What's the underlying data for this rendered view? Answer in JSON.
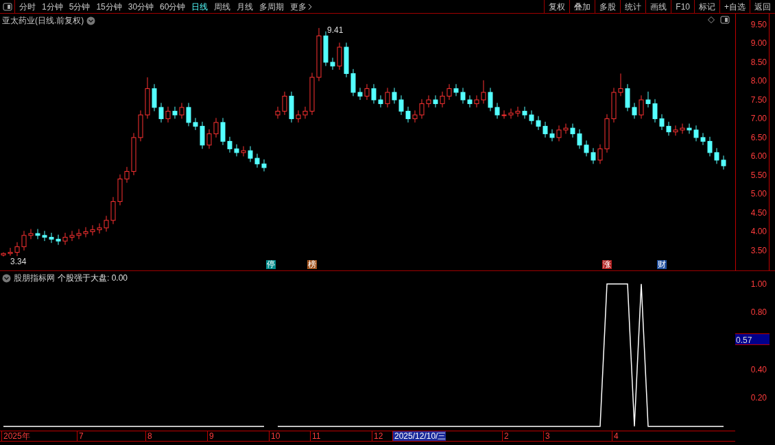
{
  "toolbar": {
    "periods": [
      {
        "label": "分时",
        "selected": false
      },
      {
        "label": "1分钟",
        "selected": false
      },
      {
        "label": "5分钟",
        "selected": false
      },
      {
        "label": "15分钟",
        "selected": false
      },
      {
        "label": "30分钟",
        "selected": false
      },
      {
        "label": "60分钟",
        "selected": false
      },
      {
        "label": "日线",
        "selected": true
      },
      {
        "label": "周线",
        "selected": false
      },
      {
        "label": "月线",
        "selected": false
      },
      {
        "label": "多周期",
        "selected": false
      }
    ],
    "more": "更多",
    "buttons": [
      "复权",
      "叠加",
      "多股",
      "统计",
      "画线",
      "F10",
      "标记",
      "+自选",
      "返回"
    ]
  },
  "price_chart": {
    "title": "亚太药业(日线.前复权)",
    "high_label": "9.41",
    "low_label": "3.34",
    "markers": [
      {
        "text": "停",
        "color": "#008b8b"
      },
      {
        "text": "榜",
        "color": "#a0521d"
      },
      {
        "text": "涨",
        "color": "#b02020"
      },
      {
        "text": "财",
        "color": "#1f4f9f"
      }
    ],
    "chart_data": {
      "type": "candlestick",
      "ylim": [
        2.97,
        9.79
      ],
      "yticks": [
        {
          "value": 9.5,
          "label": "9.50"
        },
        {
          "value": 9,
          "label": "9.00"
        },
        {
          "value": 8.5,
          "label": "8.50"
        },
        {
          "value": 8,
          "label": "8.00"
        },
        {
          "value": 7.5,
          "label": "7.50"
        },
        {
          "value": 7,
          "label": "7.00"
        },
        {
          "value": 6.5,
          "label": "6.50"
        },
        {
          "value": 6,
          "label": "6.00"
        },
        {
          "value": 5.5,
          "label": "5.50"
        },
        {
          "value": 5,
          "label": "5.00"
        },
        {
          "value": 4.5,
          "label": "4.50"
        },
        {
          "value": 4,
          "label": "4.00"
        },
        {
          "value": 3.5,
          "label": "3.50"
        }
      ],
      "ohlc": [
        [
          3.38,
          3.45,
          3.34,
          3.42
        ],
        [
          3.42,
          3.57,
          3.36,
          3.45
        ],
        [
          3.45,
          3.72,
          3.35,
          3.6
        ],
        [
          3.6,
          4.02,
          3.5,
          3.9
        ],
        [
          3.9,
          4.07,
          3.8,
          3.95
        ],
        [
          3.95,
          4.07,
          3.8,
          3.9
        ],
        [
          3.9,
          4.02,
          3.75,
          3.85
        ],
        [
          3.85,
          3.97,
          3.7,
          3.8
        ],
        [
          3.8,
          3.92,
          3.65,
          3.75
        ],
        [
          3.75,
          3.97,
          3.65,
          3.85
        ],
        [
          3.85,
          4.02,
          3.75,
          3.9
        ],
        [
          3.9,
          4.07,
          3.8,
          3.95
        ],
        [
          3.95,
          4.12,
          3.85,
          4.0
        ],
        [
          4.0,
          4.17,
          3.9,
          4.05
        ],
        [
          4.05,
          4.22,
          3.95,
          4.1
        ],
        [
          4.1,
          4.42,
          4.0,
          4.3
        ],
        [
          4.3,
          4.92,
          4.2,
          4.8
        ],
        [
          4.8,
          5.52,
          4.7,
          5.4
        ],
        [
          5.4,
          5.72,
          5.3,
          5.6
        ],
        [
          5.6,
          6.62,
          5.5,
          6.5
        ],
        [
          6.5,
          7.22,
          6.4,
          7.1
        ],
        [
          7.1,
          8.1,
          7.0,
          7.8
        ],
        [
          7.8,
          7.92,
          7.2,
          7.3
        ],
        [
          7.3,
          7.42,
          6.9,
          7.0
        ],
        [
          7.0,
          7.32,
          6.9,
          7.2
        ],
        [
          7.2,
          7.32,
          7.0,
          7.1
        ],
        [
          7.1,
          7.42,
          7.0,
          7.3
        ],
        [
          7.3,
          7.42,
          6.8,
          6.9
        ],
        [
          6.9,
          7.02,
          6.7,
          6.8
        ],
        [
          6.8,
          6.92,
          6.2,
          6.3
        ],
        [
          6.3,
          6.72,
          6.2,
          6.6
        ],
        [
          6.6,
          7.02,
          6.5,
          6.9
        ],
        [
          6.9,
          7.02,
          6.3,
          6.4
        ],
        [
          6.4,
          6.52,
          6.1,
          6.2
        ],
        [
          6.2,
          6.32,
          6.0,
          6.1
        ],
        [
          6.1,
          6.27,
          6.0,
          6.15
        ],
        [
          6.15,
          6.27,
          5.85,
          5.95
        ],
        [
          5.95,
          6.07,
          5.7,
          5.8
        ],
        [
          5.8,
          5.92,
          5.6,
          5.7
        ],
        null,
        [
          7.1,
          7.32,
          7.0,
          7.2
        ],
        [
          7.2,
          7.72,
          7.1,
          7.6
        ],
        [
          7.6,
          7.72,
          6.9,
          7.0
        ],
        [
          7.0,
          7.22,
          6.9,
          7.1
        ],
        [
          7.1,
          7.32,
          7.0,
          7.2
        ],
        [
          7.2,
          8.22,
          7.1,
          8.1
        ],
        [
          8.1,
          9.41,
          8.0,
          9.2
        ],
        [
          9.2,
          9.32,
          8.4,
          8.5
        ],
        [
          8.5,
          8.62,
          8.3,
          8.4
        ],
        [
          8.4,
          9.02,
          8.3,
          8.9
        ],
        [
          8.9,
          9.02,
          8.1,
          8.2
        ],
        [
          8.2,
          8.32,
          7.6,
          7.7
        ],
        [
          7.7,
          7.82,
          7.5,
          7.6
        ],
        [
          7.6,
          7.92,
          7.5,
          7.8
        ],
        [
          7.8,
          7.92,
          7.4,
          7.5
        ],
        [
          7.5,
          7.62,
          7.3,
          7.4
        ],
        [
          7.4,
          7.82,
          7.3,
          7.7
        ],
        [
          7.7,
          7.82,
          7.4,
          7.5
        ],
        [
          7.5,
          7.62,
          7.1,
          7.2
        ],
        [
          7.2,
          7.32,
          6.9,
          7.0
        ],
        [
          7.0,
          7.22,
          6.9,
          7.1
        ],
        [
          7.1,
          7.52,
          7.0,
          7.4
        ],
        [
          7.4,
          7.62,
          7.3,
          7.5
        ],
        [
          7.5,
          7.62,
          7.3,
          7.4
        ],
        [
          7.4,
          7.72,
          7.3,
          7.6
        ],
        [
          7.6,
          7.92,
          7.5,
          7.8
        ],
        [
          7.8,
          7.92,
          7.6,
          7.7
        ],
        [
          7.7,
          7.82,
          7.4,
          7.5
        ],
        [
          7.5,
          7.62,
          7.3,
          7.4
        ],
        [
          7.4,
          7.62,
          7.3,
          7.5
        ],
        [
          7.5,
          8.02,
          7.4,
          7.7
        ],
        [
          7.7,
          7.82,
          7.2,
          7.3
        ],
        [
          7.3,
          7.42,
          7.0,
          7.1
        ],
        [
          7.1,
          7.22,
          7.0,
          7.1
        ],
        [
          7.1,
          7.27,
          7.0,
          7.15
        ],
        [
          7.15,
          7.32,
          7.05,
          7.2
        ],
        [
          7.2,
          7.32,
          7.0,
          7.1
        ],
        [
          7.1,
          7.22,
          6.85,
          6.95
        ],
        [
          6.95,
          7.07,
          6.7,
          6.8
        ],
        [
          6.8,
          6.92,
          6.5,
          6.6
        ],
        [
          6.6,
          6.72,
          6.4,
          6.5
        ],
        [
          6.5,
          6.82,
          6.4,
          6.7
        ],
        [
          6.7,
          6.87,
          6.6,
          6.75
        ],
        [
          6.75,
          6.87,
          6.5,
          6.6
        ],
        [
          6.6,
          6.72,
          6.2,
          6.3
        ],
        [
          6.3,
          6.42,
          6.0,
          6.1
        ],
        [
          6.1,
          6.22,
          5.8,
          5.9
        ],
        [
          5.9,
          6.32,
          5.8,
          6.2
        ],
        [
          6.2,
          7.12,
          6.1,
          7.0
        ],
        [
          7.0,
          7.82,
          6.9,
          7.7
        ],
        [
          7.7,
          8.2,
          7.6,
          7.8
        ],
        [
          7.8,
          7.92,
          7.2,
          7.3
        ],
        [
          7.3,
          7.42,
          7.0,
          7.1
        ],
        [
          7.1,
          7.62,
          7.0,
          7.5
        ],
        [
          7.5,
          7.72,
          7.3,
          7.4
        ],
        [
          7.4,
          7.52,
          6.9,
          7.0
        ],
        [
          7.0,
          7.12,
          6.7,
          6.8
        ],
        [
          6.8,
          6.92,
          6.55,
          6.65
        ],
        [
          6.65,
          6.82,
          6.55,
          6.7
        ],
        [
          6.7,
          6.87,
          6.6,
          6.75
        ],
        [
          6.75,
          6.87,
          6.6,
          6.7
        ],
        [
          6.7,
          6.82,
          6.4,
          6.5
        ],
        [
          6.5,
          6.62,
          6.3,
          6.4
        ],
        [
          6.4,
          6.52,
          6.0,
          6.1
        ],
        [
          6.1,
          6.22,
          5.8,
          5.9
        ],
        [
          5.9,
          6.02,
          5.65,
          5.75
        ]
      ]
    }
  },
  "indicator": {
    "source": "股朋指标网",
    "title": "个股强于大盘: 0.00",
    "cursor_value": "0.57",
    "chart_data": {
      "type": "line",
      "ylim": [
        -0.03,
        1.09
      ],
      "yticks": [
        {
          "value": 1,
          "label": "1.00"
        },
        {
          "value": 0.8,
          "label": "0.80"
        },
        {
          "value": 0.4,
          "label": "0.40"
        },
        {
          "value": 0.2,
          "label": "0.20"
        }
      ],
      "series": [
        {
          "color": "#ffffff",
          "values": [
            0,
            0,
            0,
            0,
            0,
            0,
            0,
            0,
            0,
            0,
            0,
            0,
            0,
            0,
            0,
            0,
            0,
            0,
            0,
            0,
            0,
            0,
            0,
            0,
            0,
            0,
            0,
            0,
            0,
            0,
            0,
            0,
            0,
            0,
            0,
            0,
            0,
            0,
            0,
            null,
            0,
            0,
            0,
            0,
            0,
            0,
            0,
            0,
            0,
            0,
            0,
            0,
            0,
            0,
            0,
            0,
            0,
            0,
            0,
            0,
            0,
            0,
            0,
            0,
            0,
            0,
            0,
            0,
            0,
            0,
            0,
            0,
            0,
            0,
            0,
            0,
            0,
            0,
            0,
            0,
            0,
            0,
            0,
            0,
            0,
            0,
            0,
            0,
            1,
            1,
            1,
            1,
            0,
            1,
            0,
            0,
            0,
            0,
            0,
            0,
            0,
            0,
            0,
            0,
            0,
            0
          ]
        }
      ]
    }
  },
  "x_axis": [
    {
      "label": "2025年",
      "selected": false
    },
    {
      "label": "7",
      "selected": false
    },
    {
      "label": "8",
      "selected": false
    },
    {
      "label": "9",
      "selected": false
    },
    {
      "label": "10",
      "selected": false
    },
    {
      "label": "11",
      "selected": false
    },
    {
      "label": "12",
      "selected": false
    },
    {
      "label": "2025/12/10/三",
      "selected": true
    },
    {
      "label": "2",
      "selected": false
    },
    {
      "label": "3",
      "selected": false
    },
    {
      "label": "4",
      "selected": false
    }
  ]
}
